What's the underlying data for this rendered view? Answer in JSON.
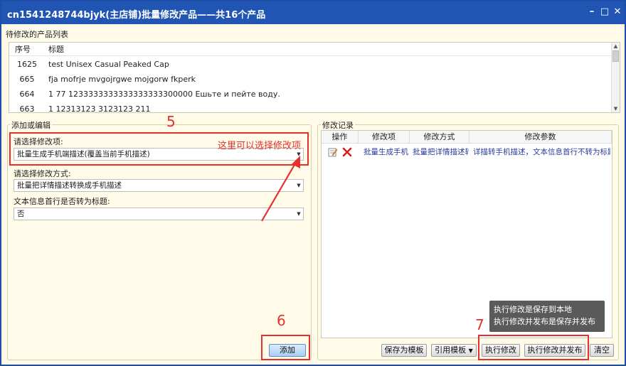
{
  "window": {
    "title": "cn1541248744bjyk(主店铺)批量修改产品——共16个产品",
    "controls": [
      "–",
      "□",
      "✕"
    ]
  },
  "product_list": {
    "label": "待修改的产品列表",
    "columns": [
      "序号",
      "标题"
    ],
    "rows": [
      {
        "no": "1625",
        "title": "test Unisex Casual Peaked Cap"
      },
      {
        "no": "665",
        "title": "fja mofrje mvgojrgwe mojgorw fkperk"
      },
      {
        "no": "664",
        "title": "1 77 1233333333333333333300000  Ешьте и пейте воду."
      },
      {
        "no": "663",
        "title": "1 12313123 3123123 211"
      }
    ]
  },
  "edit_group": {
    "title": "添加或编辑",
    "item_label": "请选择修改项:",
    "item_value": "批量生成手机端描述(覆盖当前手机描述)",
    "mode_label": "请选择修改方式:",
    "mode_value": "批量把详情描述转换成手机描述",
    "first_line_label": "文本信息首行是否转为标题:",
    "first_line_value": "否",
    "add_button": "添加"
  },
  "log_group": {
    "title": "修改记录",
    "columns": [
      "操作",
      "修改项",
      "修改方式",
      "修改参数"
    ],
    "rows": [
      {
        "item": "批量生成手机",
        "mode": "批量把详情描述转",
        "params": "详描转手机描述，文本信息首行不转为标题"
      }
    ],
    "buttons": {
      "save_template": "保存为模板",
      "use_template": "引用模板",
      "execute": "执行修改",
      "execute_publish": "执行修改并发布",
      "clear": "清空"
    }
  },
  "tooltip": {
    "line1": "执行修改是保存到本地",
    "line2": "执行修改并发布是保存并发布"
  },
  "annotations": {
    "num5": "5",
    "num6": "6",
    "num7": "7",
    "note": "这里可以选择修改项",
    "color": "#e53030"
  }
}
